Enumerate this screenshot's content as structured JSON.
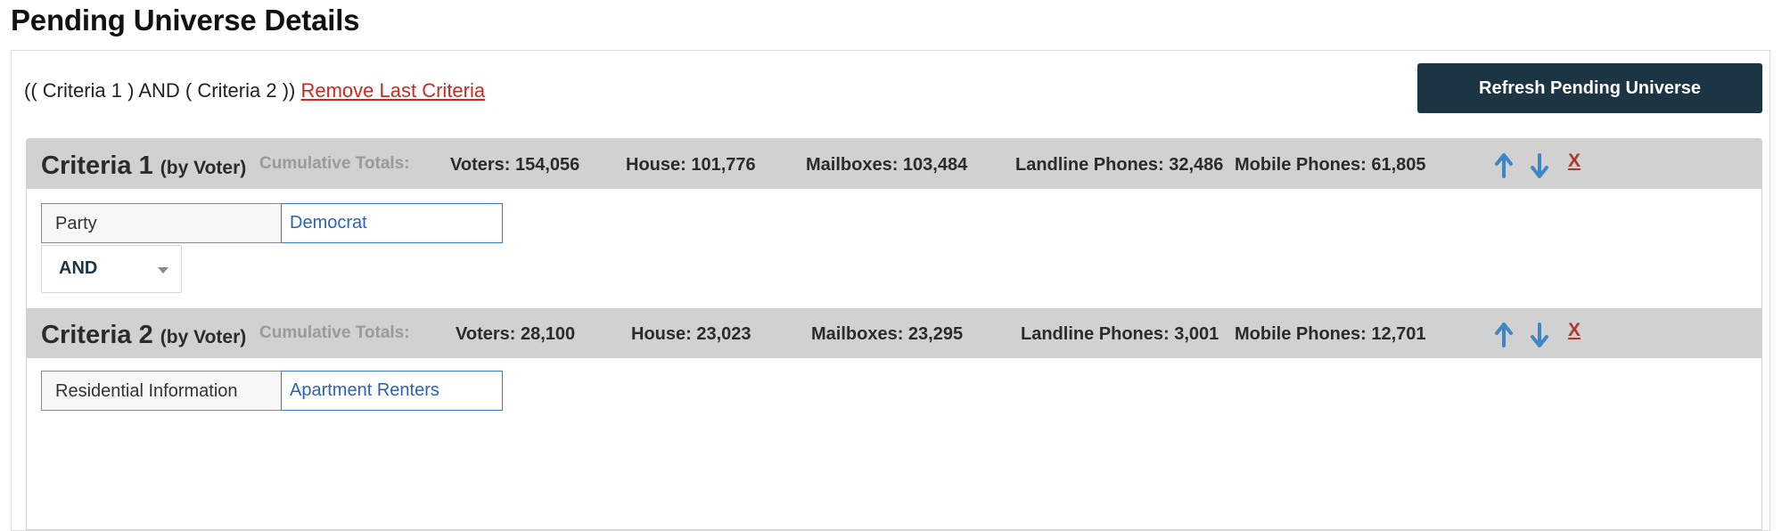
{
  "page": {
    "title": "Pending Universe Details"
  },
  "formula": {
    "text": "(( Criteria 1 ) AND ( Criteria 2 ))",
    "remove_link": "Remove Last Criteria"
  },
  "refresh_button": {
    "label": "Refresh Pending Universe"
  },
  "colors": {
    "header_bg": "#d1d1d1",
    "button_bg": "#1b3545",
    "link_red": "#d0281e",
    "value_blue": "#2a63b6",
    "arrow_blue": "#3f86c7"
  },
  "criteria": [
    {
      "title": "Criteria 1",
      "type": "(by Voter)",
      "cumulative_label": "Cumulative Totals:",
      "voters": "Voters: 154,056",
      "house": "House: 101,776",
      "mailboxes": "Mailboxes: 103,484",
      "landline": "Landline Phones: 32,486",
      "mobile": "Mobile Phones: 61,805",
      "up_icon": "arrow-up-icon",
      "down_icon": "arrow-down-icon",
      "delete_label": "X",
      "field_label": "Party",
      "field_value": "Democrat",
      "join_operator": "AND"
    },
    {
      "title": "Criteria 2",
      "type": "(by Voter)",
      "cumulative_label": "Cumulative Totals:",
      "voters": "Voters: 28,100",
      "house": "House: 23,023",
      "mailboxes": "Mailboxes: 23,295",
      "landline": "Landline Phones: 3,001",
      "mobile": "Mobile Phones: 12,701",
      "up_icon": "arrow-up-icon",
      "down_icon": "arrow-down-icon",
      "delete_label": "X",
      "field_label": "Residential Information",
      "field_value": "Apartment Renters"
    }
  ]
}
